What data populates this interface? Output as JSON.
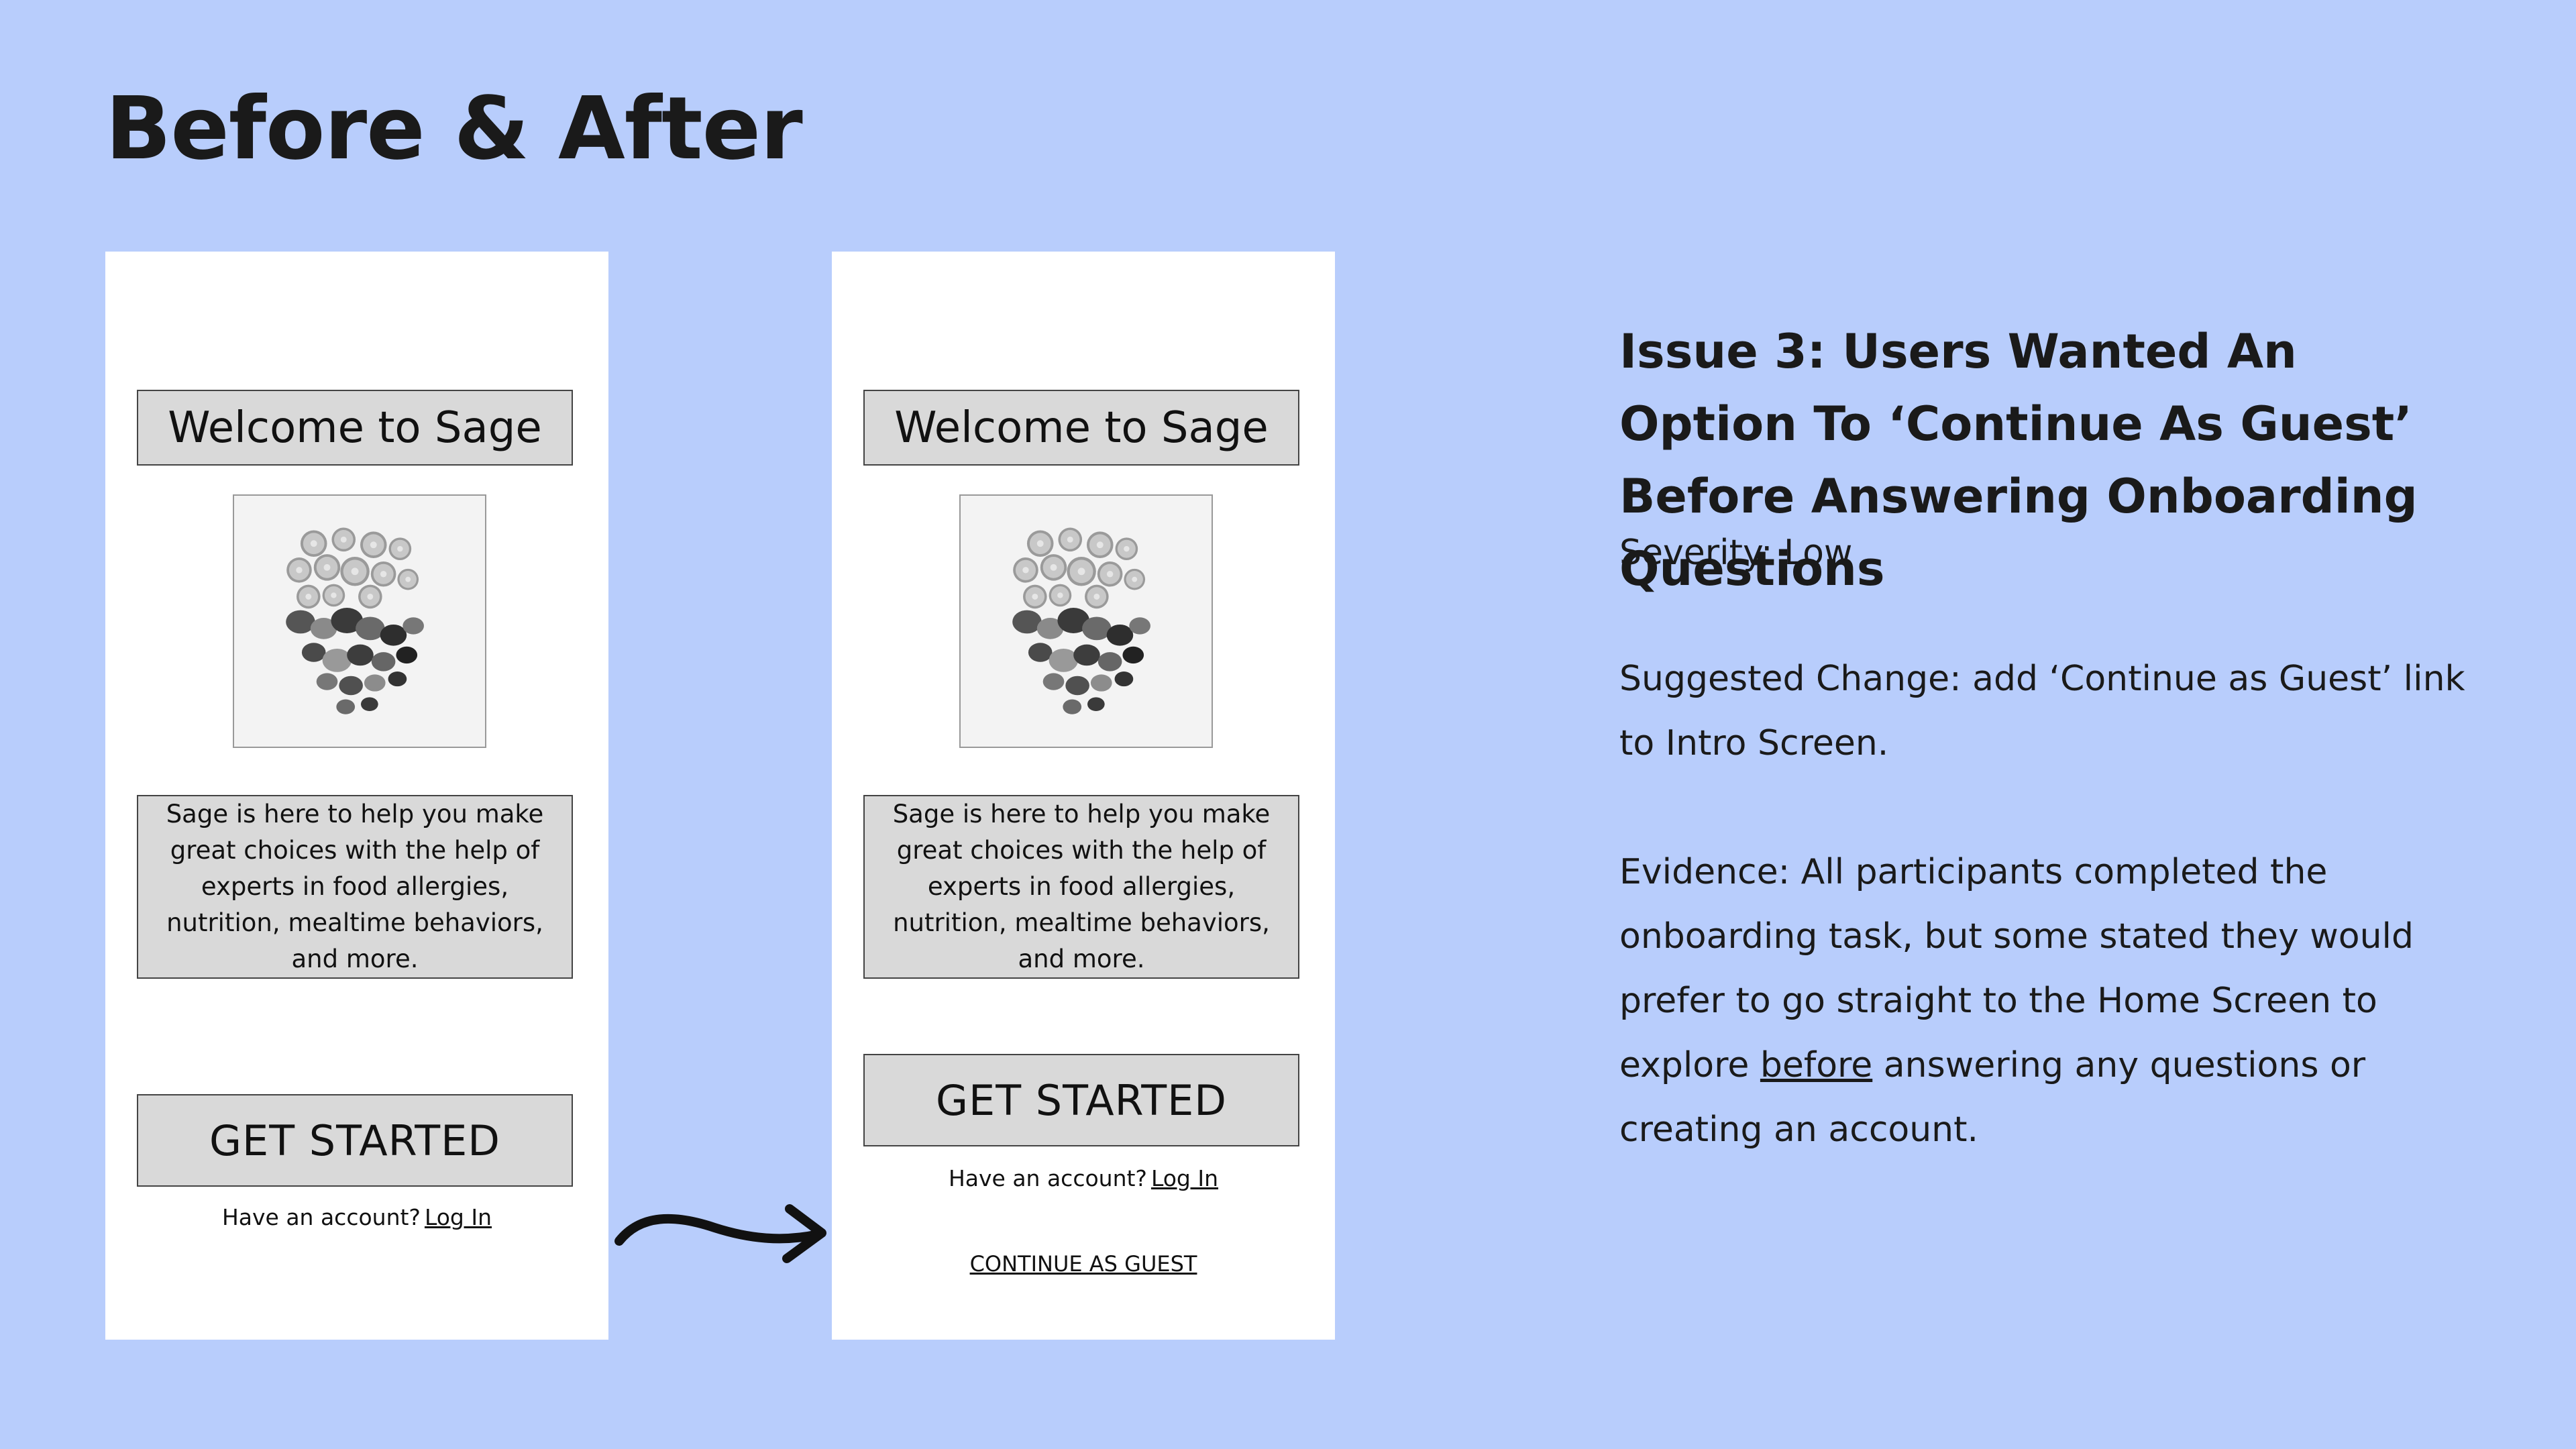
{
  "slide": {
    "title": "Before & After",
    "background_color": "#b8cdfc"
  },
  "before_screen": {
    "welcome": "Welcome to Sage",
    "image": "food-collage-grayscale",
    "description": "Sage is here to help you make great choices with the help of experts in food allergies, nutrition, mealtime behaviors, and more.",
    "get_started": "GET STARTED",
    "account_prompt": "Have an account?",
    "login_link": "Log In"
  },
  "after_screen": {
    "welcome": "Welcome to Sage",
    "image": "food-collage-grayscale",
    "description": "Sage is here to help you make great choices with the help of experts in food allergies, nutrition, mealtime behaviors, and more.",
    "get_started": "GET STARTED",
    "account_prompt": "Have an account?",
    "login_link": "Log In",
    "guest_link": "CONTINUE AS GUEST"
  },
  "arrow_icon": "arrow-right-icon",
  "issue": {
    "title": "Issue 3: Users Wanted An Option To ‘Continue As Guest’ Before Answering Onboarding Questions",
    "severity": "Severity: Low",
    "suggested_change": "Suggested Change: add ‘Continue as Guest’ link to Intro Screen.",
    "evidence_before": "Evidence: All participants completed the onboarding task, but some stated they would prefer to go straight to the Home Screen to explore ",
    "evidence_emphasis": "before",
    "evidence_after": " answering any questions or creating an account."
  }
}
